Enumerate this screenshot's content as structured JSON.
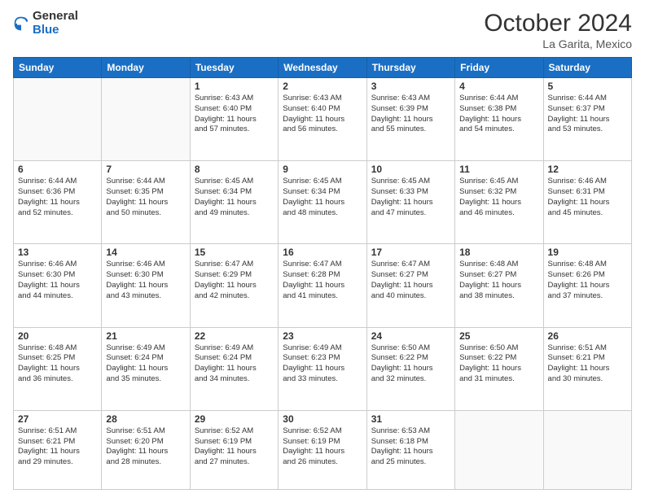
{
  "logo": {
    "general": "General",
    "blue": "Blue"
  },
  "title": "October 2024",
  "location": "La Garita, Mexico",
  "days_header": [
    "Sunday",
    "Monday",
    "Tuesday",
    "Wednesday",
    "Thursday",
    "Friday",
    "Saturday"
  ],
  "weeks": [
    [
      {
        "day": "",
        "info": ""
      },
      {
        "day": "",
        "info": ""
      },
      {
        "day": "1",
        "info": "Sunrise: 6:43 AM\nSunset: 6:40 PM\nDaylight: 11 hours\nand 57 minutes."
      },
      {
        "day": "2",
        "info": "Sunrise: 6:43 AM\nSunset: 6:40 PM\nDaylight: 11 hours\nand 56 minutes."
      },
      {
        "day": "3",
        "info": "Sunrise: 6:43 AM\nSunset: 6:39 PM\nDaylight: 11 hours\nand 55 minutes."
      },
      {
        "day": "4",
        "info": "Sunrise: 6:44 AM\nSunset: 6:38 PM\nDaylight: 11 hours\nand 54 minutes."
      },
      {
        "day": "5",
        "info": "Sunrise: 6:44 AM\nSunset: 6:37 PM\nDaylight: 11 hours\nand 53 minutes."
      }
    ],
    [
      {
        "day": "6",
        "info": "Sunrise: 6:44 AM\nSunset: 6:36 PM\nDaylight: 11 hours\nand 52 minutes."
      },
      {
        "day": "7",
        "info": "Sunrise: 6:44 AM\nSunset: 6:35 PM\nDaylight: 11 hours\nand 50 minutes."
      },
      {
        "day": "8",
        "info": "Sunrise: 6:45 AM\nSunset: 6:34 PM\nDaylight: 11 hours\nand 49 minutes."
      },
      {
        "day": "9",
        "info": "Sunrise: 6:45 AM\nSunset: 6:34 PM\nDaylight: 11 hours\nand 48 minutes."
      },
      {
        "day": "10",
        "info": "Sunrise: 6:45 AM\nSunset: 6:33 PM\nDaylight: 11 hours\nand 47 minutes."
      },
      {
        "day": "11",
        "info": "Sunrise: 6:45 AM\nSunset: 6:32 PM\nDaylight: 11 hours\nand 46 minutes."
      },
      {
        "day": "12",
        "info": "Sunrise: 6:46 AM\nSunset: 6:31 PM\nDaylight: 11 hours\nand 45 minutes."
      }
    ],
    [
      {
        "day": "13",
        "info": "Sunrise: 6:46 AM\nSunset: 6:30 PM\nDaylight: 11 hours\nand 44 minutes."
      },
      {
        "day": "14",
        "info": "Sunrise: 6:46 AM\nSunset: 6:30 PM\nDaylight: 11 hours\nand 43 minutes."
      },
      {
        "day": "15",
        "info": "Sunrise: 6:47 AM\nSunset: 6:29 PM\nDaylight: 11 hours\nand 42 minutes."
      },
      {
        "day": "16",
        "info": "Sunrise: 6:47 AM\nSunset: 6:28 PM\nDaylight: 11 hours\nand 41 minutes."
      },
      {
        "day": "17",
        "info": "Sunrise: 6:47 AM\nSunset: 6:27 PM\nDaylight: 11 hours\nand 40 minutes."
      },
      {
        "day": "18",
        "info": "Sunrise: 6:48 AM\nSunset: 6:27 PM\nDaylight: 11 hours\nand 38 minutes."
      },
      {
        "day": "19",
        "info": "Sunrise: 6:48 AM\nSunset: 6:26 PM\nDaylight: 11 hours\nand 37 minutes."
      }
    ],
    [
      {
        "day": "20",
        "info": "Sunrise: 6:48 AM\nSunset: 6:25 PM\nDaylight: 11 hours\nand 36 minutes."
      },
      {
        "day": "21",
        "info": "Sunrise: 6:49 AM\nSunset: 6:24 PM\nDaylight: 11 hours\nand 35 minutes."
      },
      {
        "day": "22",
        "info": "Sunrise: 6:49 AM\nSunset: 6:24 PM\nDaylight: 11 hours\nand 34 minutes."
      },
      {
        "day": "23",
        "info": "Sunrise: 6:49 AM\nSunset: 6:23 PM\nDaylight: 11 hours\nand 33 minutes."
      },
      {
        "day": "24",
        "info": "Sunrise: 6:50 AM\nSunset: 6:22 PM\nDaylight: 11 hours\nand 32 minutes."
      },
      {
        "day": "25",
        "info": "Sunrise: 6:50 AM\nSunset: 6:22 PM\nDaylight: 11 hours\nand 31 minutes."
      },
      {
        "day": "26",
        "info": "Sunrise: 6:51 AM\nSunset: 6:21 PM\nDaylight: 11 hours\nand 30 minutes."
      }
    ],
    [
      {
        "day": "27",
        "info": "Sunrise: 6:51 AM\nSunset: 6:21 PM\nDaylight: 11 hours\nand 29 minutes."
      },
      {
        "day": "28",
        "info": "Sunrise: 6:51 AM\nSunset: 6:20 PM\nDaylight: 11 hours\nand 28 minutes."
      },
      {
        "day": "29",
        "info": "Sunrise: 6:52 AM\nSunset: 6:19 PM\nDaylight: 11 hours\nand 27 minutes."
      },
      {
        "day": "30",
        "info": "Sunrise: 6:52 AM\nSunset: 6:19 PM\nDaylight: 11 hours\nand 26 minutes."
      },
      {
        "day": "31",
        "info": "Sunrise: 6:53 AM\nSunset: 6:18 PM\nDaylight: 11 hours\nand 25 minutes."
      },
      {
        "day": "",
        "info": ""
      },
      {
        "day": "",
        "info": ""
      }
    ]
  ]
}
